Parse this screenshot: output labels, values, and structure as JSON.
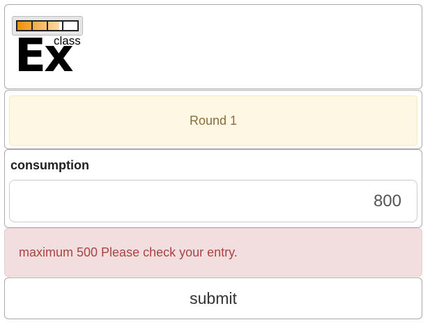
{
  "logo": {
    "text": "classEx",
    "progress_fraction": 0.7,
    "accent": "#f0900a"
  },
  "round": {
    "label": "Round 1"
  },
  "consumption": {
    "label": "consumption",
    "value": "800"
  },
  "error": {
    "message": "maximum 500 Please check your entry."
  },
  "submit": {
    "label": "submit"
  }
}
